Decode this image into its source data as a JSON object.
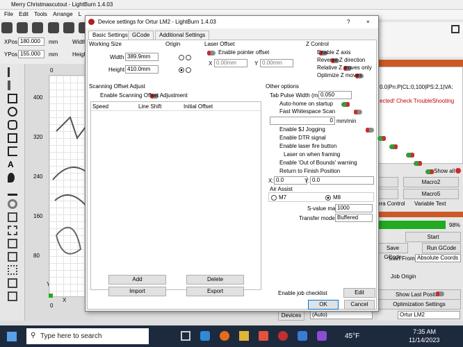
{
  "app": {
    "window_title": "Merry Christmascutout - LightBurn 1.4.03",
    "menu": [
      "File",
      "Edit",
      "Tools",
      "Arrange",
      "L"
    ],
    "xpos_label": "XPos",
    "xpos_value": "180.000",
    "ypos_label": "YPos",
    "ypos_value": "155.000",
    "unit": "mm",
    "width_label": "Width",
    "height_label": "Heigh",
    "ruler_y": [
      "400",
      "320",
      "240",
      "160",
      "80"
    ],
    "ruler_x": [
      "0",
      "X",
      "Y"
    ],
    "ruler_bottom": [
      "0"
    ]
  },
  "console": {
    "line1": "0.0|Pn:P|CL:0,100|PS:2,1|VA:",
    "line2": "ected! Check TroubleShooting",
    "show_all": "Show all"
  },
  "right_panel": {
    "macro2a": "Macro2",
    "macro2b": "Macro2",
    "macro5": "Macro5",
    "tab_era": "era Control",
    "tab_var": "Variable Text",
    "progress": "98%",
    "start": "Start",
    "save_gcode": "Save GCode",
    "run_gcode": "Run GCode",
    "start_from_label": "Start From:",
    "start_from_value": "Absolute Coords",
    "job_origin_label": "Job Origin",
    "show_last_position": "Show Last Position",
    "optimization_settings": "Optimization Settings",
    "devices": "Devices",
    "auto": "(Auto)",
    "device": "Ortur LM2"
  },
  "dialog": {
    "title": "Device settings for Ortur LM2 - LightBurn 1.4.03",
    "help": "?",
    "close": "×",
    "tabs": [
      "Basic Settings",
      "GCode",
      "Additional Settings"
    ],
    "working_size": {
      "label": "Working Size",
      "width_label": "Width",
      "width_value": "389.9mm",
      "height_label": "Height",
      "height_value": "410.0mm"
    },
    "origin": {
      "label": "Origin"
    },
    "laser_offset": {
      "label": "Laser Offset",
      "enable_pointer": "Enable pointer offset",
      "x_label": "X",
      "x_value": "0.00mm",
      "y_label": "Y",
      "y_value": "0.00mm"
    },
    "z_control": {
      "label": "Z Control",
      "items": [
        "Enable Z axis",
        "Reverse Z direction",
        "Relative Z moves only",
        "Optimize Z moves"
      ]
    },
    "scanning": {
      "label": "Scanning Offset Adjust",
      "enable": "Enable Scanning Offset Adjustment",
      "columns": [
        "Speed",
        "Line Shift",
        "Initial Offset"
      ],
      "add": "Add",
      "delete": "Delete",
      "import": "Import",
      "export": "Export"
    },
    "other": {
      "label": "Other options",
      "tab_pulse_label": "Tab Pulse Width (mm)",
      "tab_pulse_value": "0.050",
      "auto_home": "Auto-home on startup",
      "fast_whitespace": "Fast Whitespace Scan",
      "fast_value": "0",
      "fast_unit": "mm/min",
      "enable_j": "Enable $J Jogging",
      "enable_dtr": "Enable DTR signal",
      "enable_fire": "Enable laser fire button",
      "laser_on_framing": "Laser on when framing",
      "enable_bounds": "Enable 'Out of Bounds' warning",
      "return_finish": "Return to Finish Position",
      "x_label": "X:",
      "x_value": "0.0",
      "y_label": "Y:",
      "y_value": "0.0"
    },
    "air_assist": {
      "label": "Air Assist",
      "m7": "M7",
      "m8": "M8"
    },
    "svalue_label": "S-value max",
    "svalue_value": "1000",
    "transfer_label": "Transfer mode",
    "transfer_value": "Buffered",
    "job_checklist": "Enable job checklist",
    "edit": "Edit",
    "ok": "OK",
    "cancel": "Cancel"
  },
  "taskbar": {
    "search": "Type here to search",
    "weather": "45°F",
    "time": "7:35 AM",
    "date": "11/14/2023"
  }
}
